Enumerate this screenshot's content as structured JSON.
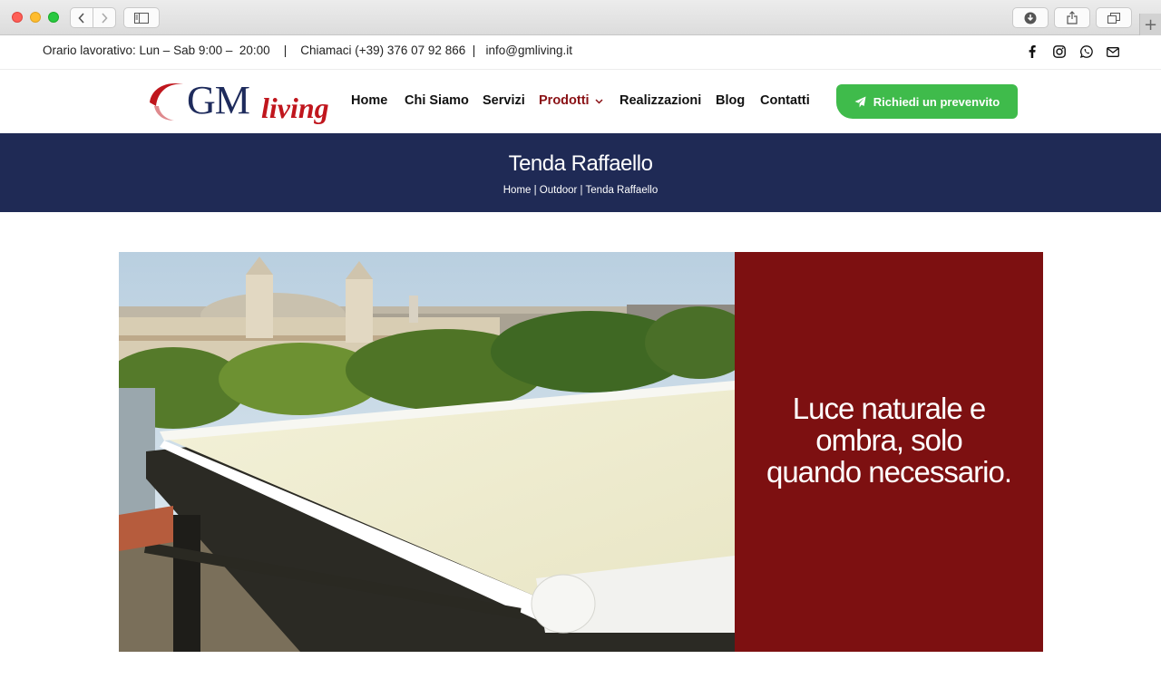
{
  "topbar": {
    "hours": "Orario lavorativo: Lun – Sab 9:00 –  20:00",
    "sep1": "|",
    "phone": "Chiamaci (+39) 376 07 92 866",
    "sep2": "|",
    "email": "info@gmliving.it",
    "social_icons": [
      "facebook-icon",
      "instagram-icon",
      "whatsapp-icon",
      "mail-icon"
    ]
  },
  "logo": {
    "gm": "GM",
    "living": "living"
  },
  "menu": {
    "items": [
      {
        "label": "Home"
      },
      {
        "label": "Chi Siamo"
      },
      {
        "label": "Servizi"
      },
      {
        "label": "Prodotti",
        "active": true
      },
      {
        "label": "Realizzazioni"
      },
      {
        "label": "Blog"
      },
      {
        "label": "Contatti"
      }
    ],
    "cta_label": "Richiedi un prevenvito"
  },
  "title_band": {
    "title": "Tenda Raffaello",
    "breadcrumb": "Home | Outdoor | Tenda Raffaello"
  },
  "feature": {
    "tagline_1": "Luce naturale e",
    "tagline_2": "ombra, solo",
    "tagline_3": "quando necessario."
  },
  "colors": {
    "navy": "#1f2a55",
    "brand_red": "#7d1011",
    "active_menu": "#8a1115",
    "cta_green": "#3fbb4b"
  }
}
